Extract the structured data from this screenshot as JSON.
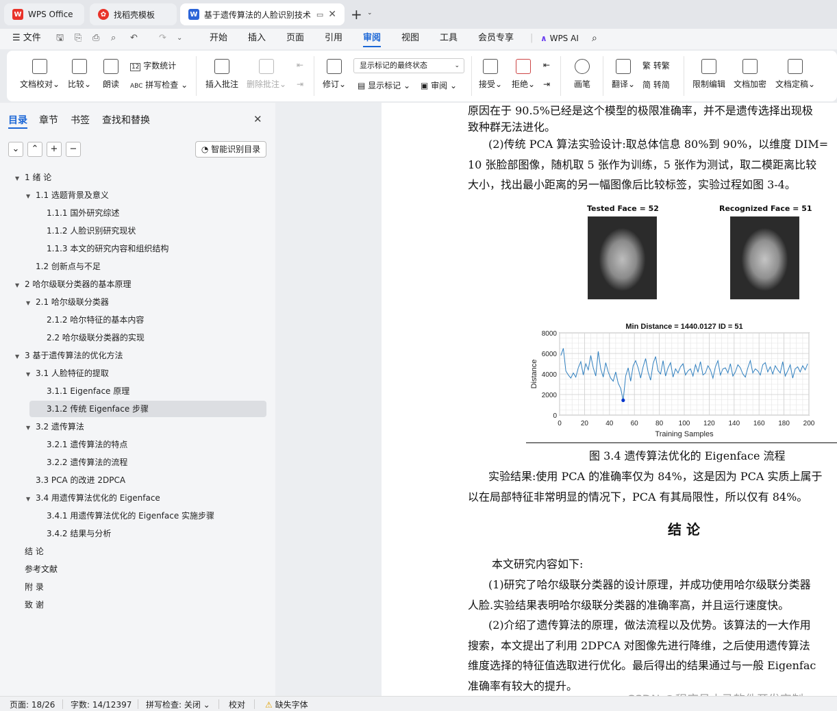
{
  "tabs": [
    {
      "label": "WPS Office"
    },
    {
      "label": "找稻壳模板"
    },
    {
      "label": "基于遗传算法的人脸识别技术"
    }
  ],
  "menu": {
    "file": "文件",
    "items": [
      "开始",
      "插入",
      "页面",
      "引用",
      "审阅",
      "视图",
      "工具",
      "会员专享"
    ],
    "active": "审阅",
    "wps_ai": "WPS AI"
  },
  "ribbon": {
    "doc_proof": "文档校对",
    "compare": "比较",
    "read_aloud": "朗读",
    "word_count": "字数统计",
    "spell_check": "拼写检查",
    "insert_comment": "插入批注",
    "delete_comment": "删除批注",
    "revise": "修订",
    "markup_select": "显示标记的最终状态",
    "show_markup": "显示标记",
    "review": "审阅",
    "accept": "接受",
    "reject": "拒绝",
    "pen": "画笔",
    "translate": "翻译",
    "to_trad": "转繁",
    "to_simp": "转简",
    "restrict_edit": "限制编辑",
    "encrypt": "文档加密",
    "finalize": "文档定稿"
  },
  "panel": {
    "tabs": [
      "目录",
      "章节",
      "书签",
      "查找和替换"
    ],
    "smart_toc": "智能识别目录",
    "toc": [
      {
        "label": "1 绪 论",
        "level": 0,
        "arrow": true
      },
      {
        "label": "1.1 选题背景及意义",
        "level": 1,
        "arrow": true
      },
      {
        "label": "1.1.1 国外研究综述",
        "level": 2,
        "arrow": false
      },
      {
        "label": "1.1.2 人脸识别研究现状",
        "level": 2,
        "arrow": false
      },
      {
        "label": "1.1.3 本文的研究内容和组织结构",
        "level": 2,
        "arrow": false
      },
      {
        "label": "1.2 创新点与不足",
        "level": 1,
        "arrow": false
      },
      {
        "label": "2 哈尔级联分类器的基本原理",
        "level": 0,
        "arrow": true
      },
      {
        "label": "2.1 哈尔级联分类器",
        "level": 1,
        "arrow": true
      },
      {
        "label": "2.1.2 哈尔特征的基本内容",
        "level": 2,
        "arrow": false
      },
      {
        "label": "2.2 哈尔级联分类器的实现",
        "level": 2,
        "arrow": false
      },
      {
        "label": "3 基于遗传算法的优化方法",
        "level": 0,
        "arrow": true
      },
      {
        "label": "3.1 人脸特征的提取",
        "level": 1,
        "arrow": true
      },
      {
        "label": "3.1.1 Eigenface 原理",
        "level": 2,
        "arrow": false
      },
      {
        "label": "3.1.2 传统 Eigenface 步骤",
        "level": 2,
        "arrow": false,
        "selected": true
      },
      {
        "label": "3.2 遗传算法",
        "level": 1,
        "arrow": true
      },
      {
        "label": "3.2.1 遗传算法的特点",
        "level": 2,
        "arrow": false
      },
      {
        "label": "3.2.2 遗传算法的流程",
        "level": 2,
        "arrow": false
      },
      {
        "label": "3.3 PCA 的改进 2DPCA",
        "level": 1,
        "arrow": false
      },
      {
        "label": "3.4 用遗传算法优化的 Eigenface",
        "level": 1,
        "arrow": true
      },
      {
        "label": "3.4.1 用遗传算法优化的 Eigenface 实施步骤",
        "level": 2,
        "arrow": false
      },
      {
        "label": "3.4.2 结果与分析",
        "level": 2,
        "arrow": false
      },
      {
        "label": "结 论",
        "level": 0,
        "arrow": false
      },
      {
        "label": "参考文献",
        "level": 0,
        "arrow": false
      },
      {
        "label": "附 录",
        "level": 0,
        "arrow": false
      },
      {
        "label": "致 谢",
        "level": 0,
        "arrow": false
      }
    ]
  },
  "doc": {
    "lines": [
      "原因在于 90.5%已经是这个模型的极限准确率，并不是遗传选择出现极",
      "致种群无法进化。",
      "(2)传统 PCA 算法实验设计:取总体信息 80%到 90%，以维度 DIM=",
      "10 张脸部图像，随机取 5 张作为训练，5 张作为测试，取二模距离比较",
      "大小，找出最小距离的另一幅图像后比较标签，实验过程如图 3-4。"
    ],
    "face_left_title": "Tested Face = 52",
    "face_right_title": "Recognized Face = 51",
    "caption": "图 3.4  遗传算法优化的 Eigenface 流程",
    "after": [
      "实验结果:使用 PCA 的准确率仅为 84%，这是因为 PCA 实质上属于",
      "以在局部特征非常明显的情况下，PCA 有其局限性，所以仅有 84%。"
    ],
    "heading": "结  论",
    "concl": [
      "本文研究内容如下:",
      "(1)研究了哈尔级联分类器的设计原理，并成功使用哈尔级联分类器",
      "人脸.实验结果表明哈尔级联分类器的准确率高，并且运行速度快。",
      "(2)介绍了遗传算法的原理，做法流程以及优势。该算法的一大作用",
      "搜索，本文提出了利用 2DPCA 对图像先进行降维，之后使用遗传算法",
      "维度选择的特征值选取进行优化。最后得出的结果通过与一般 Eigenfac",
      "准确率有较大的提升。"
    ],
    "watermark": "CSDN @程序员小马软件开发定制"
  },
  "chart_data": {
    "type": "line",
    "title": "Min Distance = 1440.0127 ID = 51",
    "xlabel": "Training Samples",
    "ylabel": "Distance",
    "xlim": [
      0,
      200
    ],
    "ylim": [
      0,
      8000
    ],
    "xticks": [
      0,
      20,
      40,
      60,
      80,
      100,
      120,
      140,
      160,
      180,
      200
    ],
    "yticks": [
      0,
      2000,
      4000,
      6000,
      8000
    ],
    "grid": true,
    "series": [
      {
        "color": "#2f7fbf",
        "x": [
          1,
          3,
          5,
          7,
          9,
          11,
          13,
          15,
          17,
          19,
          21,
          23,
          25,
          27,
          29,
          31,
          33,
          35,
          37,
          39,
          41,
          43,
          45,
          47,
          49,
          51,
          53,
          55,
          57,
          59,
          61,
          63,
          65,
          67,
          69,
          71,
          73,
          75,
          77,
          79,
          81,
          83,
          85,
          87,
          89,
          91,
          93,
          95,
          97,
          99,
          101,
          103,
          105,
          107,
          109,
          111,
          113,
          115,
          117,
          119,
          121,
          123,
          125,
          127,
          129,
          131,
          133,
          135,
          137,
          139,
          141,
          143,
          145,
          147,
          149,
          151,
          153,
          155,
          157,
          159,
          161,
          163,
          165,
          167,
          169,
          171,
          173,
          175,
          177,
          179,
          181,
          183,
          185,
          187,
          189,
          191,
          193,
          195,
          197,
          199
        ],
        "y": [
          5800,
          6500,
          4300,
          3900,
          3600,
          4100,
          3700,
          4600,
          5200,
          3900,
          5000,
          4400,
          5800,
          4600,
          3800,
          6200,
          4500,
          3700,
          5100,
          4200,
          3600,
          3300,
          4200,
          3100,
          2600,
          1440,
          3800,
          4600,
          3300,
          4800,
          5300,
          4600,
          3600,
          4700,
          5500,
          4200,
          3400,
          5000,
          5700,
          4300,
          4000,
          5300,
          3800,
          4600,
          5100,
          3700,
          4500,
          4100,
          4700,
          5000,
          3900,
          4300,
          4500,
          3800,
          4900,
          4200,
          5200,
          3900,
          4100,
          4800,
          4400,
          3600,
          4700,
          5300,
          3900,
          4500,
          4600,
          4100,
          5000,
          3800,
          4200,
          4900,
          4600,
          4000,
          3700,
          4600,
          5300,
          4100,
          4500,
          4300,
          3900,
          4900,
          5100,
          4200,
          4700,
          4000,
          4800,
          4400,
          4100,
          5200,
          3800,
          4300,
          4900,
          3600,
          4500,
          4700,
          4200,
          4800,
          4400,
          5000
        ]
      }
    ],
    "highlight_point": {
      "x": 51,
      "y": 1440
    }
  }
}
